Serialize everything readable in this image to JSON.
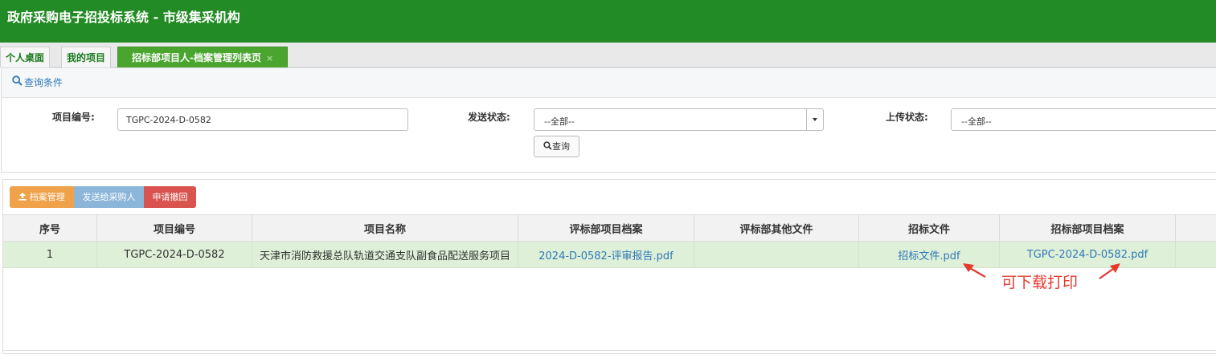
{
  "header": {
    "title": "政府采购电子招投标系统 - 市级集采机构"
  },
  "tabs": [
    {
      "label": "个人桌面"
    },
    {
      "label": "我的项目"
    },
    {
      "label": "招标部项目人-档案管理列表页",
      "close": "×"
    }
  ],
  "query": {
    "header_label": "查询条件",
    "project_no_label": "项目编号:",
    "project_no_value": "TGPC-2024-D-0582",
    "send_status_label": "发送状态:",
    "send_status_value": "--全部--",
    "upload_status_label": "上传状态:",
    "upload_status_value": "--全部--",
    "search_button": "查询"
  },
  "toolbar": {
    "archive_button": "档案管理",
    "send_button": "发送给采购人",
    "withdraw_button": "申请撤回"
  },
  "table": {
    "columns": [
      "序号",
      "项目编号",
      "项目名称",
      "评标部项目档案",
      "评标部其他文件",
      "招标文件",
      "招标部项目档案"
    ],
    "rows": [
      {
        "index": "1",
        "project_no": "TGPC-2024-D-0582",
        "project_name": "天津市消防救援总队轨道交通支队副食品配送服务项目",
        "eval_archive": "2024-D-0582-评审报告.pdf",
        "eval_other": "",
        "bid_file": "招标文件.pdf",
        "bid_archive": "TGPC-2024-D-0582.pdf"
      }
    ]
  },
  "annotation": {
    "text": "可下载打印"
  },
  "colors": {
    "header_bg": "#238b25",
    "active_tab": "#4aa52e",
    "link": "#2f78b8",
    "row_highlight": "#dff0d8",
    "annotation": "#e53a2e"
  }
}
